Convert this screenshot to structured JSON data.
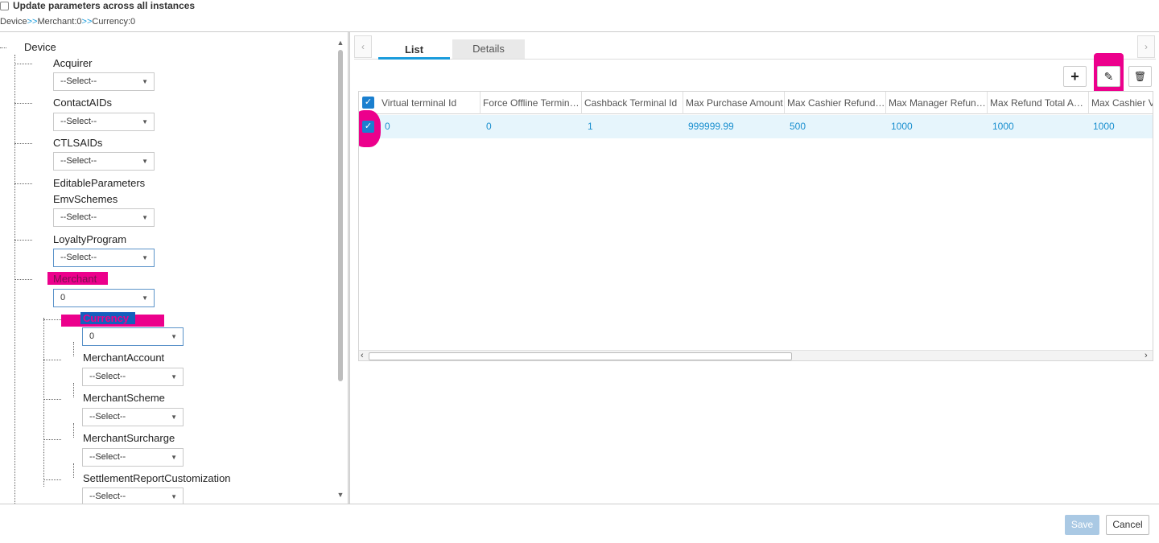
{
  "header": {
    "update_all_label": "Update parameters across all instances",
    "crumbs": [
      "Device",
      "Merchant:0",
      "Currency:0"
    ],
    "crumb_sep": ">>"
  },
  "tree": {
    "root": "Device",
    "scroll_up": "▲",
    "scroll_down": "▼",
    "nodes": [
      {
        "label": "Acquirer",
        "select": "--Select--"
      },
      {
        "label": "ContactAIDs",
        "select": "--Select--"
      },
      {
        "label": "CTLSAIDs",
        "select": "--Select--"
      },
      {
        "label": "EditableParameters"
      },
      {
        "label": "EmvSchemes",
        "select": "--Select--"
      },
      {
        "label": "LoyaltyProgram",
        "select": "--Select--"
      },
      {
        "label": "Merchant",
        "select": "0"
      }
    ],
    "children": [
      {
        "label": "Currency",
        "select": "0"
      },
      {
        "label": "MerchantAccount",
        "select": "--Select--"
      },
      {
        "label": "MerchantScheme",
        "select": "--Select--"
      },
      {
        "label": "MerchantSurcharge",
        "select": "--Select--"
      },
      {
        "label": "SettlementReportCustomization",
        "select": "--Select--"
      }
    ]
  },
  "tabs": {
    "prev": "‹",
    "next": "›",
    "list": "List",
    "details": "Details"
  },
  "toolbar": {
    "add_glyph": "+",
    "edit_glyph": "✎",
    "delete_glyph": "🗑"
  },
  "grid": {
    "columns": [
      "Virtual terminal Id",
      "Force Offline Termin…",
      "Cashback Terminal Id",
      "Max Purchase Amount",
      "Max Cashier Refund…",
      "Max Manager Refun…",
      "Max Refund Total A…",
      "Max Cashier Vo"
    ],
    "rows": [
      [
        "0",
        "0",
        "1",
        "999999.99",
        "500",
        "1000",
        "1000",
        "1000"
      ]
    ],
    "check": "✓",
    "hscroll_left": "‹",
    "hscroll_right": "›"
  },
  "footer": {
    "save": "Save",
    "cancel": "Cancel"
  },
  "colors": {
    "accent": "#1a9cdc",
    "highlight": "#ec008c",
    "row_selected": "#e6f5fc"
  }
}
